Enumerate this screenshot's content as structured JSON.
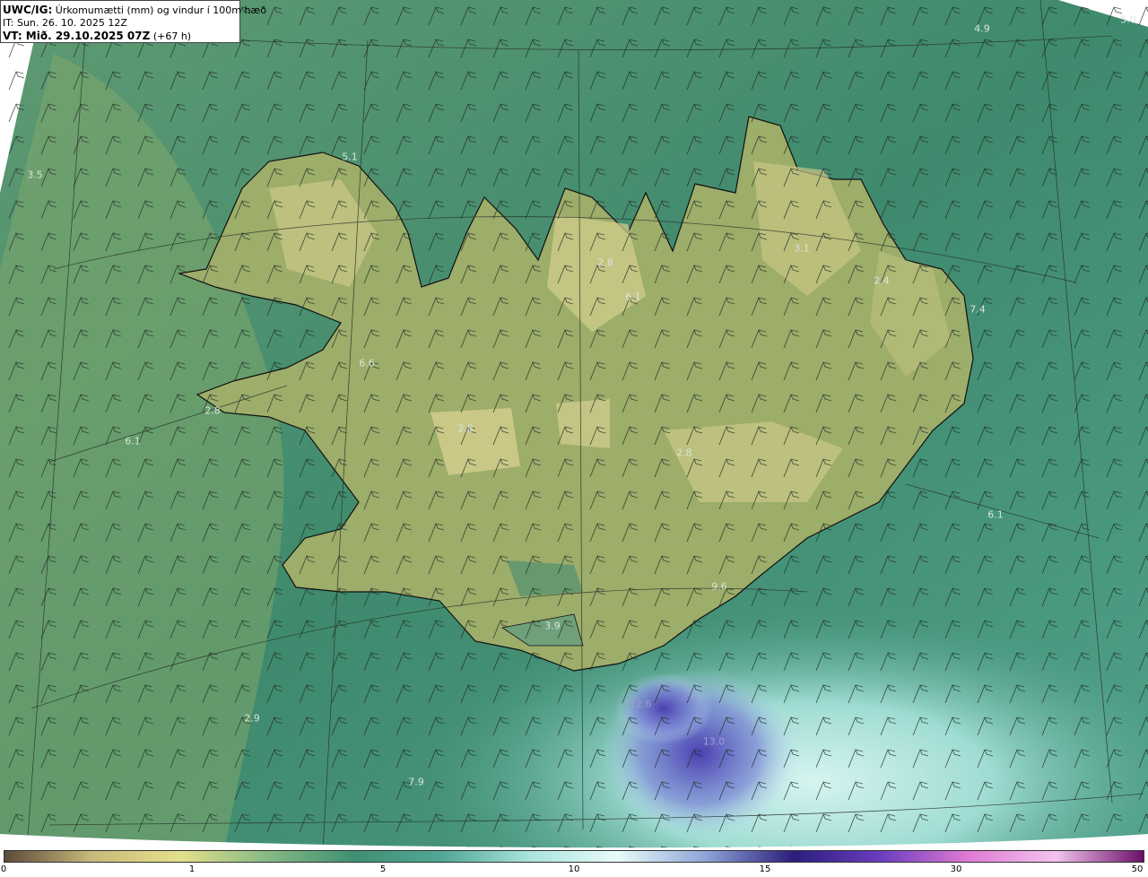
{
  "header": {
    "model": "UWC/IG:",
    "description": "Úrkomumætti (mm) og vindur í 100m hæð",
    "it_line": "IT: Sun. 26. 10. 2025 12Z",
    "vt_prefix": "VT: Mið. 29.10.2025 07Z",
    "vt_suffix": "(+67 h)"
  },
  "map_values": [
    "4.9",
    "5.0",
    "3.5",
    "5.1",
    "2.8",
    "3.1",
    "2.4",
    "6.1",
    "7.4",
    "6.6",
    "2.8",
    "6.1",
    "2.8",
    "2.8",
    "6.1",
    "9.6",
    "3.9",
    "2.9",
    "12.6",
    "13.0",
    "7.9"
  ],
  "colorbar": {
    "ticks": [
      "0",
      "1",
      "5",
      "10",
      "15",
      "30",
      "50"
    ],
    "colors": [
      "#5c4a3a",
      "#c7ba7a",
      "#e4e08a",
      "#86b984",
      "#3f8f73",
      "#52a896",
      "#a9e4dd",
      "#e8fbf8",
      "#8ea4d8",
      "#2b1e7c",
      "#6a3dbf",
      "#e07ad4",
      "#f2c3ec",
      "#6b0f68"
    ]
  }
}
